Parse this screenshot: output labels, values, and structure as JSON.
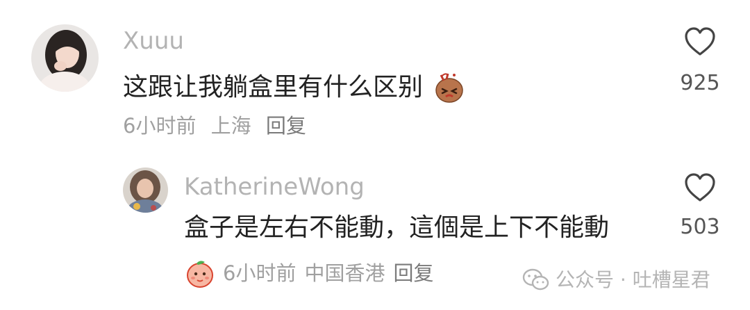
{
  "comments": [
    {
      "username": "Xuuu",
      "text": "这跟让我躺盒里有什么区别",
      "time": "6小时前",
      "location": "上海",
      "reply_label": "回复",
      "like_count": "925",
      "emoji_icon": "confused-potato-emoji-icon"
    },
    {
      "username": "KatherineWong",
      "text": "盒子是左右不能動，這個是上下不能動",
      "time": "6小时前",
      "location": "中国香港",
      "reply_label": "回复",
      "like_count": "503",
      "badge_icon": "peach-emoji-icon"
    }
  ],
  "watermark": {
    "text": "公众号 · 吐槽星君",
    "icon": "wechat-icon"
  },
  "colors": {
    "username": "#b3b3b3",
    "content": "#222222",
    "meta": "#a0a0a0",
    "count": "#555555"
  }
}
